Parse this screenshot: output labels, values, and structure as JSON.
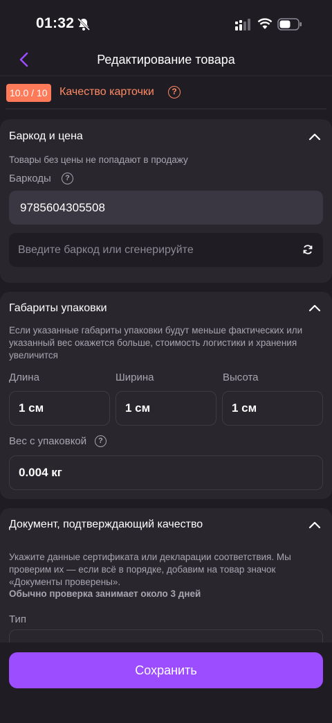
{
  "status_bar": {
    "time": "01:32"
  },
  "nav": {
    "title": "Редактирование товара"
  },
  "quality": {
    "score": "10.0 / 10",
    "label": "Качество карточки",
    "help": "?"
  },
  "barcode_section": {
    "title": "Баркод и цена",
    "hint": "Товары без цены не попадают в продажу",
    "barcodes_label": "Баркоды",
    "help": "?",
    "barcode_value": "9785604305508",
    "new_barcode_placeholder": "Введите баркод или сгенерируйте"
  },
  "package_section": {
    "title": "Габариты упаковки",
    "hint": "Если указанные габариты упаковки будут меньше фактических или указанный вес окажется больше, стоимость логистики и хранения увеличится",
    "length_label": "Длина",
    "width_label": "Ширина",
    "height_label": "Высота",
    "length_value": "1 см",
    "width_value": "1 см",
    "height_value": "1 см",
    "weight_label": "Вес с упаковкой",
    "help": "?",
    "weight_value": "0.004 кг"
  },
  "document_section": {
    "title": "Документ, подтверждающий качество",
    "hint": "Укажите данные сертификата или декларации соответствия. Мы проверим их — если всё в порядке, добавим на товар значок «Документы проверены».",
    "hint_bold": "Обычно проверка занимает около 3 дней",
    "type_label": "Тип"
  },
  "footer": {
    "save_label": "Сохранить"
  },
  "colors": {
    "accent": "#9b4dff",
    "quality_orange": "#ff7a59",
    "background": "#1f1c24",
    "card": "#29262e"
  }
}
